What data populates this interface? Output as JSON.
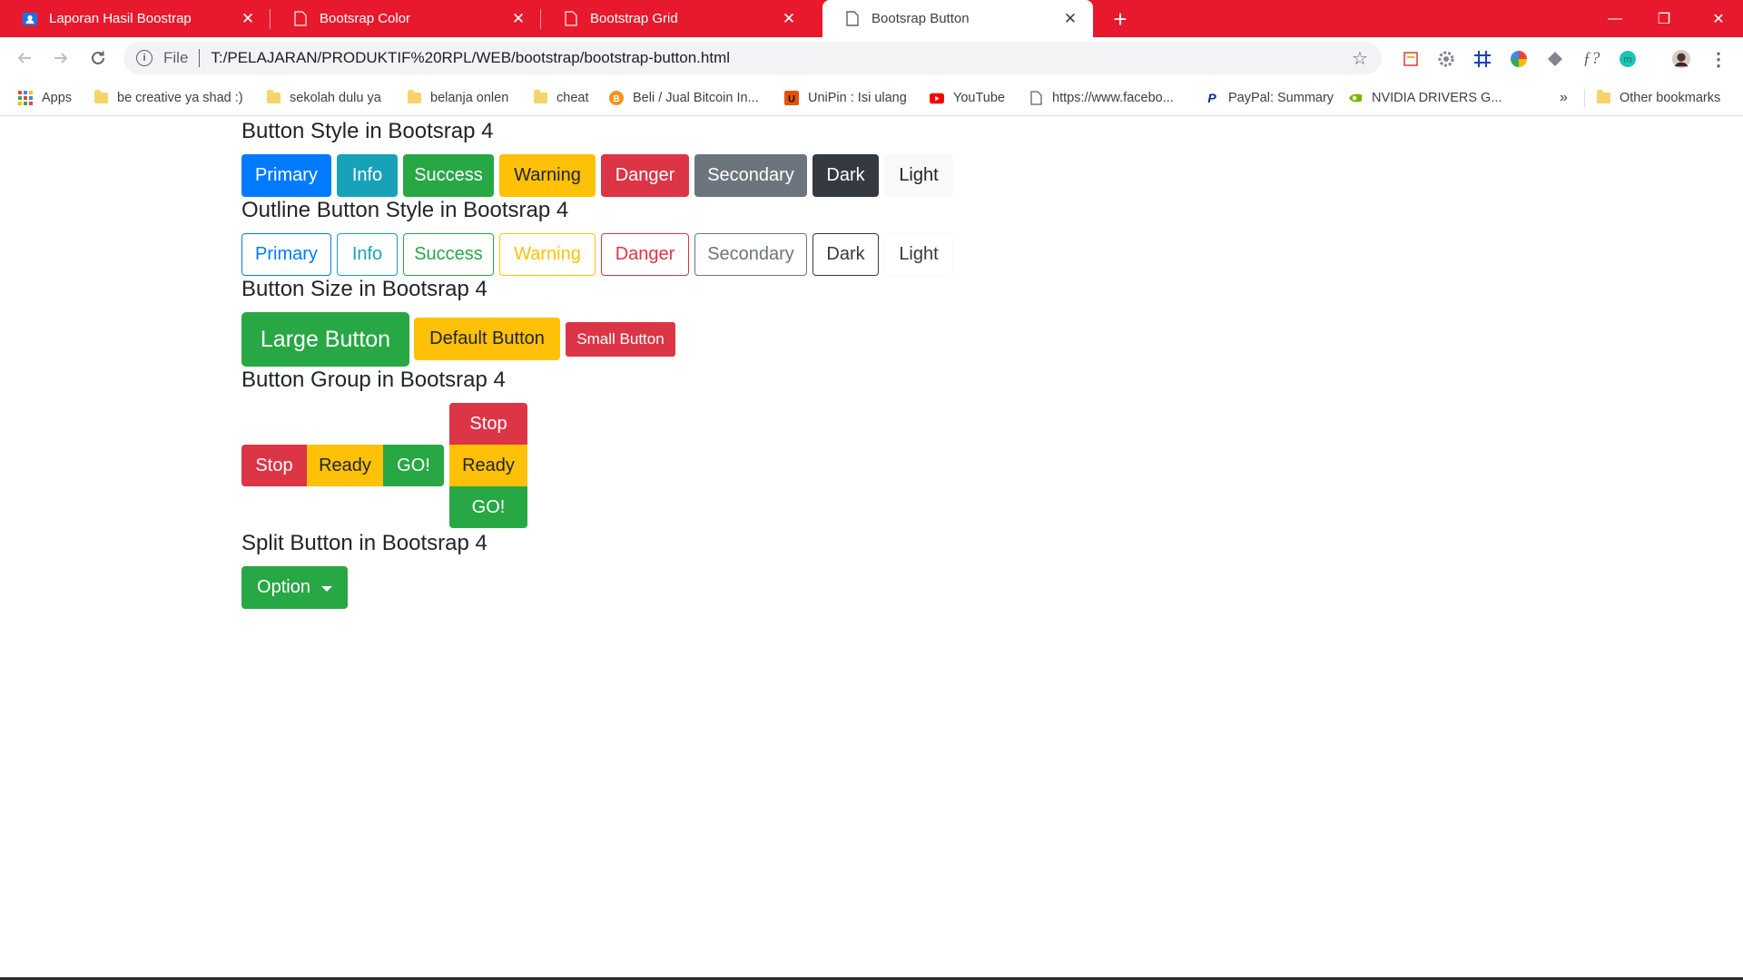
{
  "browser": {
    "tabs": [
      {
        "title": "Laporan Hasil Boostrap",
        "icon": "contact-icon",
        "active": false
      },
      {
        "title": "Bootsrap Color",
        "icon": "page-icon",
        "active": false
      },
      {
        "title": "Bootstrap Grid",
        "icon": "page-icon",
        "active": false
      },
      {
        "title": "Bootsrap Button",
        "icon": "page-icon",
        "active": true
      }
    ],
    "tab_close_glyph": "✕",
    "new_tab_glyph": "+",
    "window_controls": {
      "minimize": "—",
      "restore": "❐",
      "close": "✕"
    },
    "address": {
      "scheme_label": "File",
      "url": "T:/PELAJARAN/PRODUKTIF%20RPL/WEB/bootstrap/bootstrap-button.html"
    },
    "bookmarks": [
      {
        "label": "Apps",
        "icon": "apps-icon"
      },
      {
        "label": "be creative ya shad :)",
        "icon": "folder-icon"
      },
      {
        "label": "sekolah dulu ya",
        "icon": "folder-icon"
      },
      {
        "label": "belanja onlen",
        "icon": "folder-icon"
      },
      {
        "label": "cheat",
        "icon": "folder-icon"
      },
      {
        "label": "Beli / Jual Bitcoin In...",
        "icon": "bitcoin-icon"
      },
      {
        "label": "UniPin : Isi ulang",
        "icon": "unipin-icon"
      },
      {
        "label": "YouTube",
        "icon": "youtube-icon"
      },
      {
        "label": "https://www.facebo...",
        "icon": "page-icon"
      },
      {
        "label": "PayPal: Summary",
        "icon": "paypal-icon"
      },
      {
        "label": "NVIDIA DRIVERS G...",
        "icon": "nvidia-icon"
      }
    ],
    "bookmarks_overflow": "»",
    "other_bookmarks": "Other bookmarks"
  },
  "page": {
    "section1": {
      "heading": "Button Style in Bootsrap 4",
      "buttons": [
        "Primary",
        "Info",
        "Success",
        "Warning",
        "Danger",
        "Secondary",
        "Dark",
        "Light"
      ]
    },
    "section2": {
      "heading": "Outline Button Style in Bootsrap 4",
      "buttons": [
        "Primary",
        "Info",
        "Success",
        "Warning",
        "Danger",
        "Secondary",
        "Dark",
        "Light"
      ]
    },
    "section3": {
      "heading": "Button Size in Bootsrap 4",
      "large": "Large Button",
      "default": "Default Button",
      "small": "Small Button"
    },
    "section4": {
      "heading": "Button Group in Bootsrap 4",
      "horizontal": [
        "Stop",
        "Ready",
        "GO!"
      ],
      "vertical": [
        "Stop",
        "Ready",
        "GO!"
      ]
    },
    "section5": {
      "heading": "Split Button in Bootsrap 4",
      "dropdown": "Option"
    }
  },
  "colors": {
    "tab_strip": "#e8192c",
    "primary": "#007bff",
    "info": "#17a2b8",
    "success": "#28a745",
    "warning": "#ffc107",
    "danger": "#dc3545",
    "secondary": "#6c757d",
    "dark": "#343a40",
    "light": "#f8f9fa"
  }
}
